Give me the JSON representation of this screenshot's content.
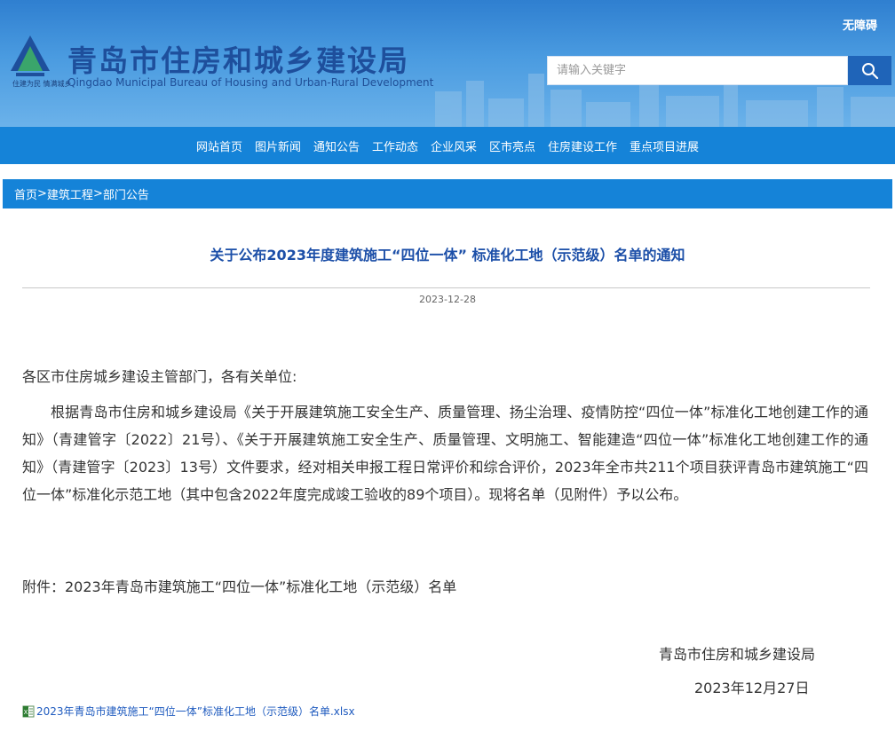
{
  "header": {
    "accessible_label": "无障碍",
    "site_title": "青岛市住房和城乡建设局",
    "site_title_en": "Qingdao Municipal Bureau of Housing and Urban-Rural Development",
    "slogan": "住建为民 情满城乡",
    "search_placeholder": "请输入关键字",
    "search_icon": "search-icon"
  },
  "nav": {
    "items": [
      "网站首页",
      "图片新闻",
      "通知公告",
      "工作动态",
      "企业风采",
      "区市亮点",
      "住房建设工作",
      "重点项目进展"
    ]
  },
  "breadcrumb": {
    "home": "首页",
    "sep1": ">",
    "category": "建筑工程",
    "sep2": ">",
    "section": "部门公告"
  },
  "article": {
    "title": "关于公布2023年度建筑施工“四位一体” 标准化工地（示范级）名单的通知",
    "date": "2023-12-28",
    "salutation": "各区市住房城乡建设主管部门，各有关单位:",
    "body": "根据青岛市住房和城乡建设局《关于开展建筑施工安全生产、质量管理、扬尘治理、疫情防控“四位一体”标准化工地创建工作的通知》（青建管字〔2022〕21号）、《关于开展建筑施工安全生产、质量管理、文明施工、智能建造“四位一体”标准化工地创建工作的通知》（青建管字〔2023〕13号）文件要求，经对相关申报工程日常评价和综合评价，2023年全市共211个项目获评青岛市建筑施工“四位一体”标准化示范工地（其中包含2022年度完成竣工验收的89个项目）。现将名单（见附件）予以公布。",
    "attachment": "附件：2023年青岛市建筑施工“四位一体”标准化工地（示范级）名单",
    "signature": "青岛市住房和城乡建设局",
    "signature_date": "2023年12月27日",
    "file_link": "2023年青岛市建筑施工“四位一体”标准化工地（示范级）名单.xlsx",
    "file_icon": "excel-file-icon"
  },
  "colors": {
    "nav_bg": "#1583d8",
    "title_blue": "#1c4fa8",
    "link_blue": "#1f5bbf"
  }
}
